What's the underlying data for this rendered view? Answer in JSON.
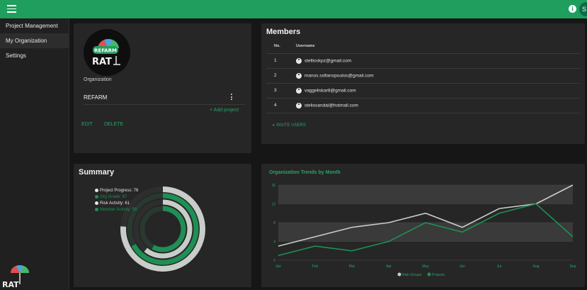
{
  "topbar": {
    "avatar_initial": "S"
  },
  "sidebar": {
    "items": [
      {
        "label": "Project Management"
      },
      {
        "label": "My Organization"
      },
      {
        "label": "Settings"
      }
    ],
    "logo_text": "RAT"
  },
  "organization": {
    "logo_badge": "REFARM",
    "logo_text": "RAT",
    "label": "Organization",
    "name": "REFARM",
    "add_project": "Add project",
    "edit": "EDIT",
    "delete": "DELETE"
  },
  "members": {
    "title": "Members",
    "columns": [
      "No.",
      "Username"
    ],
    "rows": [
      {
        "no": "1",
        "username": "stellioskpz@gmail.com"
      },
      {
        "no": "2",
        "username": "manos.sofianopoulos@gmail.com"
      },
      {
        "no": "3",
        "username": "vaggeliskar8@gmail.com"
      },
      {
        "no": "4",
        "username": "steliosandal@hotmail.com"
      }
    ],
    "invite": "INVITE USERS"
  },
  "summary": {
    "title": "Summary",
    "legend": [
      {
        "label": "Project Progress: 76",
        "color": "#e6e6e6"
      },
      {
        "label": "Org Grade: 67",
        "color": "#1f8f55"
      },
      {
        "label": "Risk Activity: 61",
        "color": "#e6e6e6"
      },
      {
        "label": "Member Activity: 58",
        "color": "#1f8f55"
      }
    ]
  },
  "colors": {
    "accent": "#1f9e5e",
    "light_series": "#c9cdca",
    "dark_series": "#1f8f55"
  },
  "chart_data": [
    {
      "type": "radial-bar",
      "categories": [
        "Project Progress",
        "Org Grade",
        "Risk Activity",
        "Member Activity"
      ],
      "values": [
        76,
        67,
        61,
        58
      ],
      "max": 100
    },
    {
      "type": "line",
      "title": "Organization Trends by Month",
      "x": [
        "Jan",
        "Feb",
        "Mar",
        "Apr",
        "May",
        "Jun",
        "Jul",
        "Aug",
        "Sep"
      ],
      "ylim": [
        0,
        16
      ],
      "yticks": [
        0,
        4,
        8,
        12,
        16
      ],
      "series": [
        {
          "name": "Risk Groups",
          "values": [
            3,
            5,
            7,
            8,
            10,
            7,
            11,
            12,
            16
          ]
        },
        {
          "name": "Projects",
          "values": [
            1,
            3,
            2,
            4,
            8,
            6,
            10,
            12,
            5
          ]
        }
      ],
      "legend": "bottom-center"
    }
  ]
}
